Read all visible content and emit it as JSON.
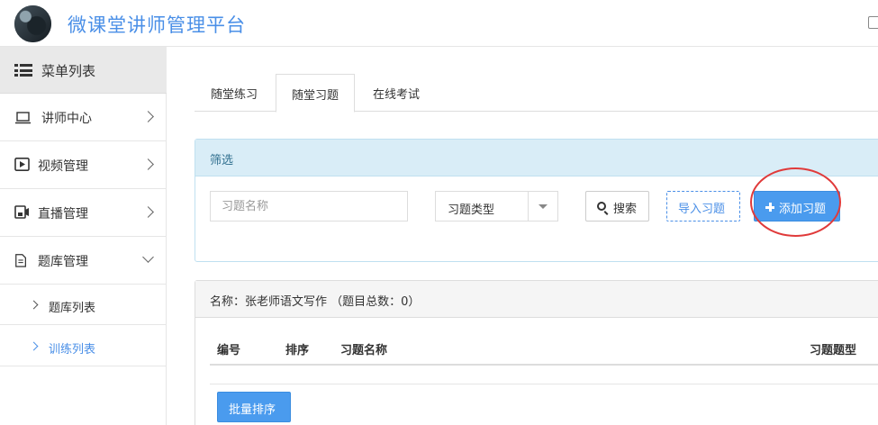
{
  "header": {
    "title": "微课堂讲师管理平台"
  },
  "sidebar": {
    "menu_title": "菜单列表",
    "items": [
      {
        "label": "讲师中心",
        "icon": "laptop-icon"
      },
      {
        "label": "视频管理",
        "icon": "play-icon"
      },
      {
        "label": "直播管理",
        "icon": "camera-icon"
      },
      {
        "label": "题库管理",
        "icon": "document-icon",
        "expanded": true
      }
    ],
    "sub_items": [
      {
        "label": "题库列表"
      },
      {
        "label": "训练列表",
        "active": true
      }
    ]
  },
  "tabs": [
    {
      "label": "随堂练习"
    },
    {
      "label": "随堂习题",
      "active": true
    },
    {
      "label": "在线考试"
    }
  ],
  "filter": {
    "title": "筛选",
    "name_placeholder": "习题名称",
    "type_select": "习题类型",
    "search_label": "搜索",
    "import_label": "导入习题",
    "add_label": "添加习题"
  },
  "list": {
    "title": "名称：张老师语文写作  （题目总数：0）",
    "columns": [
      "编号",
      "排序",
      "习题名称",
      "习题题型"
    ],
    "batch_label": "批量排序"
  },
  "colors": {
    "accent": "#4a8fe7",
    "primary_button": "#4a9bee",
    "filter_header": "#d9edf7",
    "highlight": "#e03a3a"
  }
}
